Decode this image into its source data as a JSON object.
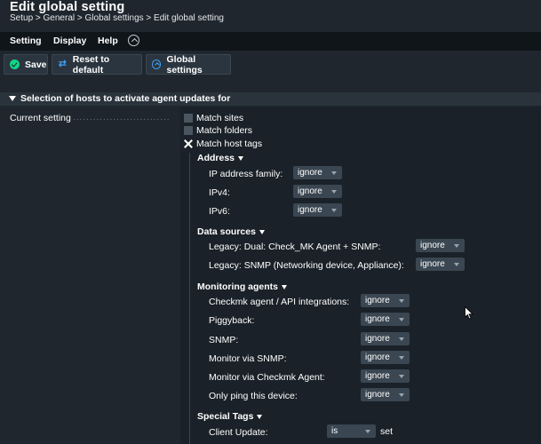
{
  "header": {
    "title": "Edit global setting",
    "breadcrumb": "Setup > General > Global settings > Edit global setting"
  },
  "menu": {
    "items": [
      "Setting",
      "Display",
      "Help"
    ]
  },
  "toolbar": {
    "save": "Save",
    "reset": "Reset to default",
    "global": "Global settings"
  },
  "section": {
    "title": "Selection of hosts to activate agent updates for"
  },
  "current_setting": {
    "label": "Current setting",
    "dots": "...................................................."
  },
  "match": {
    "sites": "Match sites",
    "folders": "Match folders",
    "host_tags": "Match host tags"
  },
  "groups": {
    "address": {
      "title": "Address",
      "rows": [
        {
          "label": "IP address family:",
          "value": "ignore"
        },
        {
          "label": "IPv4:",
          "value": "ignore"
        },
        {
          "label": "IPv6:",
          "value": "ignore"
        }
      ]
    },
    "data_sources": {
      "title": "Data sources",
      "rows": [
        {
          "label": "Legacy: Dual: Check_MK Agent + SNMP:",
          "value": "ignore"
        },
        {
          "label": "Legacy: SNMP (Networking device, Appliance):",
          "value": "ignore"
        }
      ]
    },
    "monitoring_agents": {
      "title": "Monitoring agents",
      "rows": [
        {
          "label": "Checkmk agent / API integrations:",
          "value": "ignore"
        },
        {
          "label": "Piggyback:",
          "value": "ignore"
        },
        {
          "label": "SNMP:",
          "value": "ignore"
        },
        {
          "label": "Monitor via SNMP:",
          "value": "ignore"
        },
        {
          "label": "Monitor via Checkmk Agent:",
          "value": "ignore"
        },
        {
          "label": "Only ping this device:",
          "value": "ignore"
        }
      ]
    },
    "special_tags": {
      "title": "Special Tags",
      "rows": [
        {
          "label": "Client Update:",
          "value": "is",
          "suffix": "set"
        }
      ]
    }
  },
  "colors": {
    "background": "#1f262e",
    "menubar": "#10151a",
    "accent_green": "#13d389",
    "accent_blue": "#3fa5ff"
  }
}
